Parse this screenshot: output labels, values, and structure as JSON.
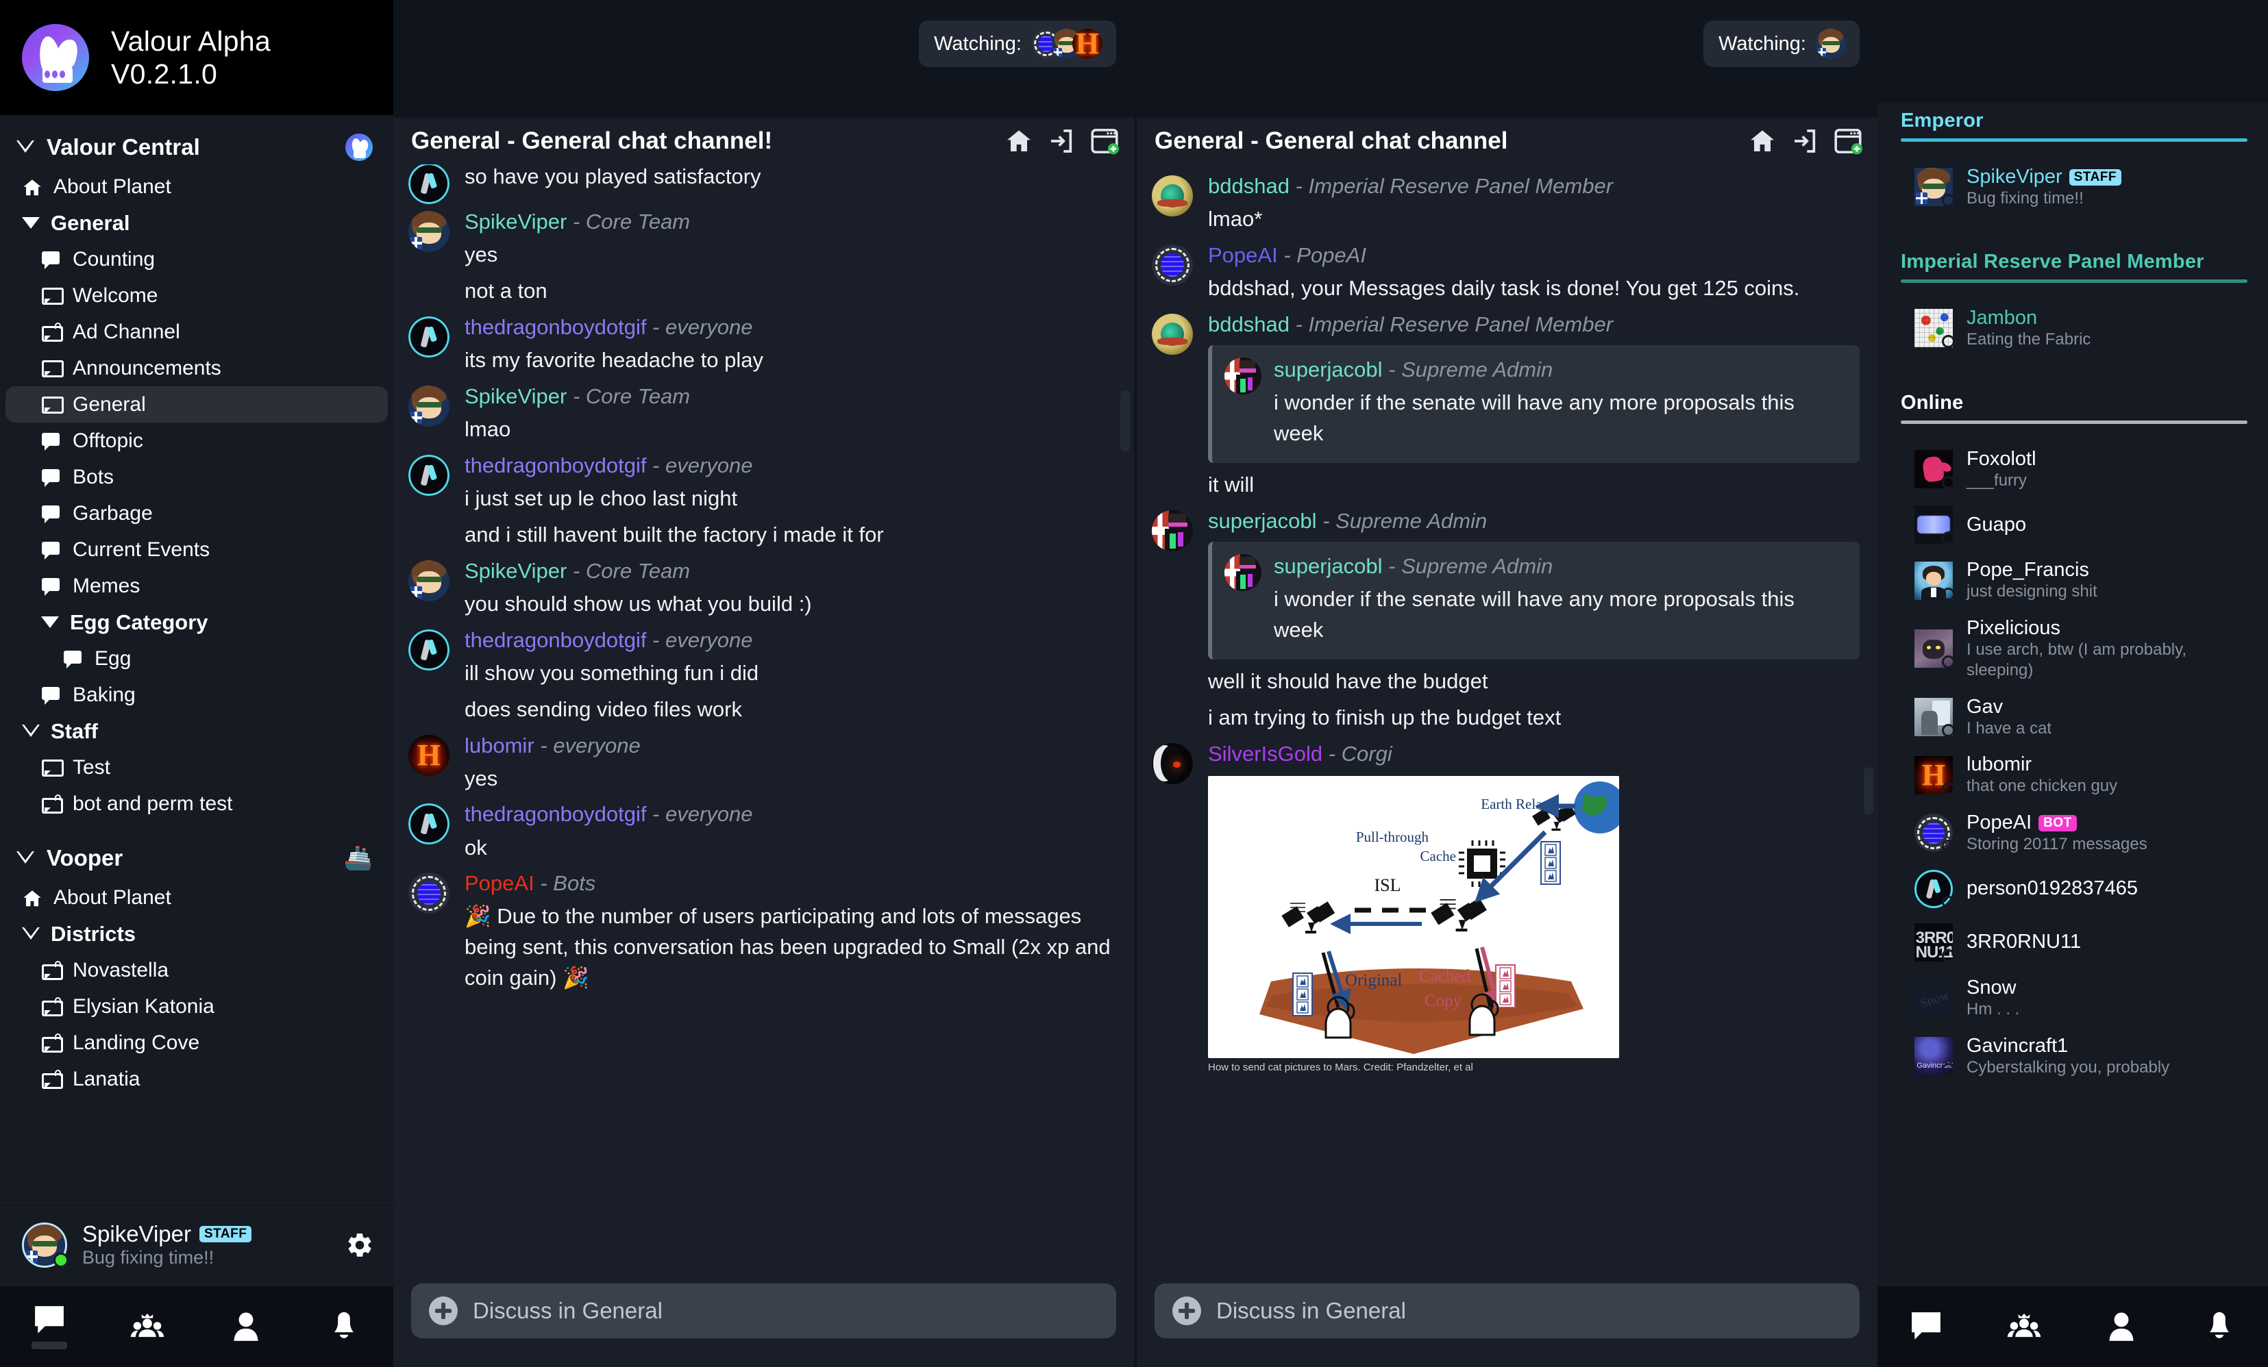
{
  "brand": {
    "line1": "Valour Alpha",
    "line2": "V0.2.1.0",
    "logo_icon": "valour-logo-icon"
  },
  "sidebar": {
    "planets": [
      {
        "name": "Valour Central",
        "icon": "valour-planet-icon",
        "items": [
          {
            "label": "About Planet",
            "icon": "home-icon",
            "kind": "link",
            "indent": 0
          },
          {
            "label": "General",
            "icon": "chevron-down-solid-icon",
            "kind": "category",
            "indent": 0
          },
          {
            "label": "Counting",
            "icon": "chat-filled-icon",
            "kind": "channel",
            "indent": 1
          },
          {
            "label": "Welcome",
            "icon": "chat-outline-icon",
            "kind": "channel",
            "indent": 1
          },
          {
            "label": "Ad Channel",
            "icon": "chat-locked-icon",
            "kind": "channel",
            "indent": 1
          },
          {
            "label": "Announcements",
            "icon": "chat-outline-icon",
            "kind": "channel",
            "indent": 1
          },
          {
            "label": "General",
            "icon": "chat-outline-icon",
            "kind": "channel",
            "indent": 1,
            "selected": true
          },
          {
            "label": "Offtopic",
            "icon": "chat-filled-icon",
            "kind": "channel",
            "indent": 1
          },
          {
            "label": "Bots",
            "icon": "chat-filled-icon",
            "kind": "channel",
            "indent": 1
          },
          {
            "label": "Garbage",
            "icon": "chat-filled-icon",
            "kind": "channel",
            "indent": 1
          },
          {
            "label": "Current Events",
            "icon": "chat-filled-icon",
            "kind": "channel",
            "indent": 1
          },
          {
            "label": "Memes",
            "icon": "chat-filled-icon",
            "kind": "channel",
            "indent": 1
          },
          {
            "label": "Egg Category",
            "icon": "chevron-down-solid-icon",
            "kind": "category",
            "indent": 1
          },
          {
            "label": "Egg",
            "icon": "chat-filled-icon",
            "kind": "channel",
            "indent": 2
          },
          {
            "label": "Baking",
            "icon": "chat-filled-icon",
            "kind": "channel",
            "indent": 1
          },
          {
            "label": "Staff",
            "icon": "chevron-down-hollow-icon",
            "kind": "category",
            "indent": 0
          },
          {
            "label": "Test",
            "icon": "chat-outline-icon",
            "kind": "channel",
            "indent": 1
          },
          {
            "label": "bot and perm test",
            "icon": "chat-locked-icon",
            "kind": "channel",
            "indent": 1
          }
        ]
      },
      {
        "name": "Vooper",
        "icon": "vooper-planet-emoji",
        "emoji": "🚢",
        "items": [
          {
            "label": "About Planet",
            "icon": "home-icon",
            "kind": "link",
            "indent": 0
          },
          {
            "label": "Districts",
            "icon": "chevron-down-hollow-icon",
            "kind": "category",
            "indent": 0
          },
          {
            "label": "Novastella",
            "icon": "chat-locked-icon",
            "kind": "channel",
            "indent": 1
          },
          {
            "label": "Elysian Katonia",
            "icon": "chat-locked-icon",
            "kind": "channel",
            "indent": 1
          },
          {
            "label": "Landing Cove",
            "icon": "chat-locked-icon",
            "kind": "channel",
            "indent": 1
          },
          {
            "label": "Lanatia",
            "icon": "chat-locked-icon",
            "kind": "channel",
            "indent": 1
          }
        ]
      }
    ],
    "user": {
      "name": "SpikeViper",
      "badge": "STAFF",
      "status": "Bug fixing time!!",
      "presence": "online",
      "gear_icon": "gear-icon"
    },
    "nav": [
      {
        "icon": "chat-icon",
        "name": "nav-chat",
        "active": true
      },
      {
        "icon": "planets-crown-icon",
        "name": "nav-planets",
        "active": false
      },
      {
        "icon": "person-icon",
        "name": "nav-profile",
        "active": false
      },
      {
        "icon": "bell-icon",
        "name": "nav-notifications",
        "active": false
      }
    ]
  },
  "panels": [
    {
      "title": "General - General chat channel!",
      "header_icons": [
        "home-icon",
        "join-arrow-icon",
        "new-window-icon"
      ],
      "watching": {
        "label": "Watching:",
        "avatars": [
          "popeai-avatar",
          "spikeviper-avatar",
          "lubomir-avatar"
        ]
      },
      "composer": {
        "placeholder": "Discuss in General",
        "plus_icon": "plus-circle-icon"
      },
      "messages": [
        {
          "type": "cut",
          "lines": [
            "so have you played satisfactory"
          ],
          "avatar": "thedragonboydotgif-avatar"
        },
        {
          "type": "msg",
          "author": "SpikeViper",
          "author_color": "#6fe0c3",
          "role": "Core Team",
          "avatar": "spikeviper-avatar",
          "lines": [
            "yes",
            "not a ton"
          ]
        },
        {
          "type": "msg",
          "author": "thedragonboydotgif",
          "author_color": "#8b7bf5",
          "role": "everyone",
          "avatar": "thedragonboydotgif-avatar",
          "lines": [
            "its my favorite headache to play"
          ]
        },
        {
          "type": "msg",
          "author": "SpikeViper",
          "author_color": "#6fe0c3",
          "role": "Core Team",
          "avatar": "spikeviper-avatar",
          "lines": [
            "lmao"
          ]
        },
        {
          "type": "msg",
          "author": "thedragonboydotgif",
          "author_color": "#8b7bf5",
          "role": "everyone",
          "avatar": "thedragonboydotgif-avatar",
          "lines": [
            "i just set up le choo last night",
            "and i still havent built the factory i made it for"
          ]
        },
        {
          "type": "msg",
          "author": "SpikeViper",
          "author_color": "#6fe0c3",
          "role": "Core Team",
          "avatar": "spikeviper-avatar",
          "lines": [
            "you should show us what you build :)"
          ]
        },
        {
          "type": "msg",
          "author": "thedragonboydotgif",
          "author_color": "#8b7bf5",
          "role": "everyone",
          "avatar": "thedragonboydotgif-avatar",
          "lines": [
            "ill show you something fun i did",
            "does sending video files work"
          ]
        },
        {
          "type": "msg",
          "author": "lubomir",
          "author_color": "#8b7bf5",
          "role": "everyone",
          "avatar": "lubomir-avatar",
          "lines": [
            "yes"
          ]
        },
        {
          "type": "msg",
          "author": "thedragonboydotgif",
          "author_color": "#8b7bf5",
          "role": "everyone",
          "avatar": "thedragonboydotgif-avatar",
          "lines": [
            "ok"
          ]
        },
        {
          "type": "msg",
          "author": "PopeAI",
          "author_color": "#e8301b",
          "role": "Bots",
          "avatar": "popeai-avatar",
          "lines": [
            "🎉 Due to the number of users participating and lots of messages being sent, this conversation has been upgraded to Small (2x xp and coin gain) 🎉"
          ]
        }
      ]
    },
    {
      "title": "General - General chat channel",
      "header_icons": [
        "home-icon",
        "join-arrow-icon",
        "new-window-icon"
      ],
      "watching": {
        "label": "Watching:",
        "avatars": [
          "spikeviper-avatar"
        ]
      },
      "composer": {
        "placeholder": "Discuss in General",
        "plus_icon": "plus-circle-icon"
      },
      "messages": [
        {
          "type": "msg",
          "author": "bddshad",
          "author_color": "#6fe0c3",
          "role": "Imperial Reserve Panel Member",
          "avatar": "bddshad-avatar",
          "lines": [
            "lmao*"
          ]
        },
        {
          "type": "msg",
          "author": "PopeAI",
          "author_color": "#6a62f0",
          "role": "PopeAI",
          "avatar": "popeai-avatar",
          "lines": [
            "bddshad, your Messages daily task is done! You get 125 coins."
          ]
        },
        {
          "type": "msg",
          "author": "bddshad",
          "author_color": "#6fe0c3",
          "role": "Imperial Reserve Panel Member",
          "avatar": "bddshad-avatar",
          "reply": {
            "author": "superjacobl",
            "author_color": "#6fe0c3",
            "role": "Supreme Admin",
            "avatar": "superjacobl-avatar",
            "lines": [
              "i wonder if the senate will have any more proposals this week"
            ]
          },
          "lines": [
            "it will"
          ]
        },
        {
          "type": "msg",
          "author": "superjacobl",
          "author_color": "#6fe0c3",
          "role": "Supreme Admin",
          "avatar": "superjacobl-avatar",
          "reply": {
            "author": "superjacobl",
            "author_color": "#6fe0c3",
            "role": "Supreme Admin",
            "avatar": "superjacobl-avatar",
            "lines": [
              "i wonder if the senate will have any more proposals this week"
            ]
          },
          "lines": [
            "well it should have the budget",
            "i am trying to finish up the budget text"
          ]
        },
        {
          "type": "msg",
          "author": "SilverIsGold",
          "author_color": "#b03cf0",
          "role": "Corgi",
          "avatar": "silverisgold-avatar",
          "image": {
            "caption": "How to send cat pictures to Mars. Credit: Pfandzelter, et al",
            "labels": [
              "Pull-through",
              "Cache",
              "Earth Relay",
              "ISL",
              "Original",
              "Cached",
              "Copy"
            ]
          },
          "lines": []
        }
      ]
    }
  ],
  "members": {
    "groups": [
      {
        "role": "Emperor",
        "color": "#6fe0f5",
        "rule_color": "#3fbcd8",
        "members": [
          {
            "name": "SpikeViper",
            "name_color": "#6fe0f5",
            "badge": "STAFF",
            "status": "Bug fixing time!!",
            "presence": "online",
            "avatar": "spikeviper-avatar"
          }
        ]
      },
      {
        "role": "Imperial Reserve Panel Member",
        "color": "#4ec9b4",
        "rule_color": "#2f8f82",
        "members": [
          {
            "name": "Jambon",
            "name_color": "#4ec9b4",
            "status": "Eating the Fabric",
            "presence": "dnd",
            "avatar": "jambon-avatar"
          }
        ]
      },
      {
        "role": "Online",
        "color": "#ffffff",
        "rule_color": "#aeb4be",
        "members": [
          {
            "name": "Foxolotl",
            "name_color": "#ffffff",
            "status": "___furry",
            "presence": "online",
            "avatar": "foxolotl-avatar"
          },
          {
            "name": "Guapo",
            "name_color": "#ffffff",
            "status": "",
            "presence": "online",
            "avatar": "guapo-avatar"
          },
          {
            "name": "Pope_Francis",
            "name_color": "#ffffff",
            "status": "just designing shit",
            "presence": "online",
            "avatar": "pope-francis-avatar"
          },
          {
            "name": "Pixelicious",
            "name_color": "#ffffff",
            "status": "I use arch, btw (I am probably, sleeping)",
            "presence": "idle",
            "avatar": "pixelicious-avatar"
          },
          {
            "name": "Gav",
            "name_color": "#ffffff",
            "status": "I have a cat",
            "presence": "online",
            "avatar": "gav-avatar"
          },
          {
            "name": "lubomir",
            "name_color": "#ffffff",
            "status": "that one chicken guy",
            "presence": "online",
            "avatar": "lubomir-avatar"
          },
          {
            "name": "PopeAI",
            "name_color": "#ffffff",
            "badge": "BOT",
            "status": "Storing 20117 messages",
            "presence": "online",
            "avatar": "popeai-avatar"
          },
          {
            "name": "person0192837465",
            "name_color": "#ffffff",
            "status": "",
            "presence": "idle",
            "avatar": "valour-default-avatar"
          },
          {
            "name": "3RR0RNU11",
            "name_color": "#ffffff",
            "status": "",
            "presence": "online",
            "avatar": "error-null-avatar"
          },
          {
            "name": "Snow",
            "name_color": "#ffffff",
            "status": "Hm . . .",
            "presence": "dnd",
            "avatar": "snow-avatar"
          },
          {
            "name": "Gavincraft1",
            "name_color": "#ffffff",
            "status": "Cyberstalking you, probably",
            "presence": "online",
            "avatar": "gavincraft1-avatar"
          }
        ]
      }
    ],
    "nav": [
      {
        "icon": "chat-icon",
        "name": "nav-chat"
      },
      {
        "icon": "planets-crown-icon",
        "name": "nav-planets"
      },
      {
        "icon": "person-icon",
        "name": "nav-profile"
      },
      {
        "icon": "bell-icon",
        "name": "nav-notifications"
      }
    ]
  }
}
